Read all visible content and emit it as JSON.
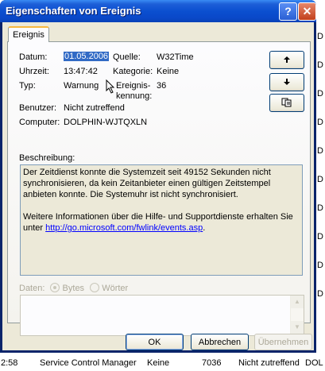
{
  "window": {
    "title": "Eigenschaften von Ereignis",
    "help_glyph": "?",
    "close_glyph": "✕"
  },
  "tab": {
    "label": "Ereignis"
  },
  "fields": {
    "datum_label": "Datum:",
    "datum_value": "01.05.2006",
    "uhrzeit_label": "Uhrzeit:",
    "uhrzeit_value": "13:47:42",
    "typ_label": "Typ:",
    "typ_value": "Warnung",
    "quelle_label": "Quelle:",
    "quelle_value": "W32Time",
    "kategorie_label": "Kategorie:",
    "kategorie_value": "Keine",
    "ereigniskennung_label_line1": "Ereignis-",
    "ereigniskennung_label_line2": "kennung:",
    "ereigniskennung_value": "36",
    "benutzer_label": "Benutzer:",
    "benutzer_value": "Nicht zutreffend",
    "computer_label": "Computer:",
    "computer_value": "DOLPHIN-WJTQXLN"
  },
  "nav_buttons": {
    "up_icon": "arrow-up-icon",
    "down_icon": "arrow-down-icon",
    "copy_icon": "copy-icon"
  },
  "description": {
    "label": "Beschreibung:",
    "paragraph1": "Der Zeitdienst konnte die Systemzeit seit 49152 Sekunden nicht synchronisieren, da kein Zeitanbieter einen gültigen Zeitstempel anbieten konnte. Die Systemuhr ist nicht synchronisiert.",
    "paragraph2_prefix": "Weitere Informationen über die Hilfe- und Supportdienste erhalten Sie unter ",
    "link": "http://go.microsoft.com/fwlink/events.asp",
    "paragraph2_suffix": "."
  },
  "data_section": {
    "label": "Daten:",
    "option_bytes": "Bytes",
    "option_words": "Wörter",
    "selected": "Bytes"
  },
  "buttons": {
    "ok": "OK",
    "cancel": "Abbrechen",
    "apply": "Übernehmen"
  },
  "background": {
    "right_fragments": [
      "D",
      "D",
      "D",
      "D",
      "D",
      "D",
      "D",
      "D",
      "D",
      "D"
    ],
    "status_row": {
      "time": "2:58",
      "source": "Service Control Manager",
      "category": "Keine",
      "id": "7036",
      "user": "Nicht zutreffend",
      "computer": "DOL"
    }
  }
}
